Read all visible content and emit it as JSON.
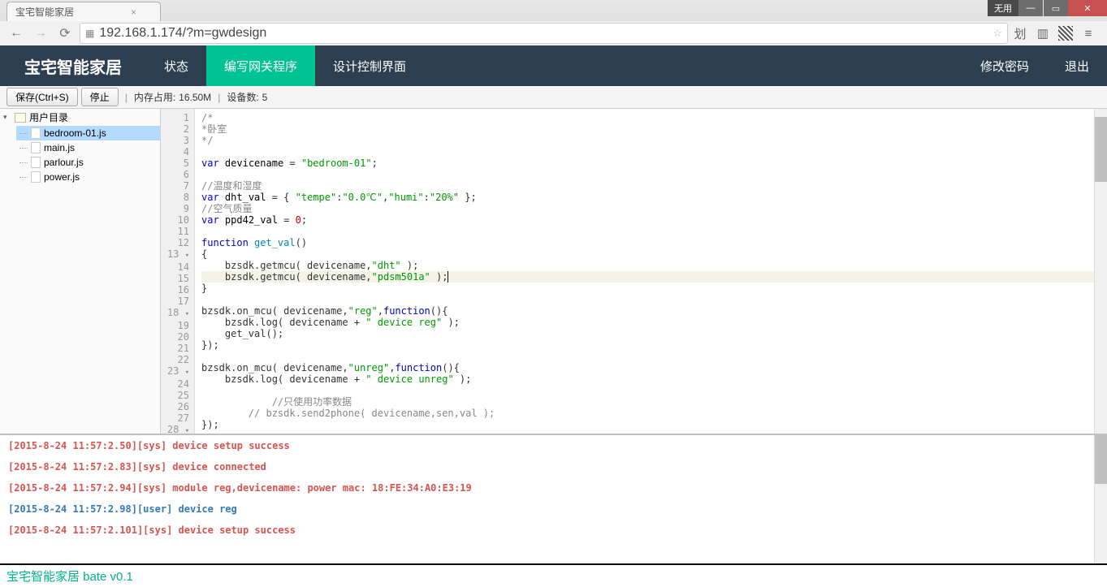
{
  "browser": {
    "tab_title": "宝宅智能家居",
    "url": "192.168.1.174/?m=gwdesign",
    "window_wy": "无用"
  },
  "nav": {
    "brand": "宝宅智能家居",
    "items": [
      "状态",
      "编写网关程序",
      "设计控制界面"
    ],
    "active": 1,
    "right": [
      "修改密码",
      "退出"
    ]
  },
  "toolbar": {
    "save": "保存(Ctrl+S)",
    "stop": "停止",
    "mem_label": "内存占用:",
    "mem_val": "16.50M",
    "dev_label": "设备数:",
    "dev_val": "5"
  },
  "tree": {
    "root": "用户目录",
    "files": [
      "bedroom-01.js",
      "main.js",
      "parlour.js",
      "power.js"
    ],
    "selected": 0
  },
  "code": {
    "lines": [
      {
        "n": 1,
        "fold": "",
        "html": "<span class='cm'>/*</span>"
      },
      {
        "n": 2,
        "fold": "",
        "html": "<span class='cm'>*卧室</span>"
      },
      {
        "n": 3,
        "fold": "",
        "html": "<span class='cm'>*/</span>"
      },
      {
        "n": 4,
        "fold": "",
        "html": " "
      },
      {
        "n": 5,
        "fold": "",
        "html": "<span class='kw'>var</span> <span class='id'>devicename</span> = <span class='str'>\"bedroom-01\"</span>;"
      },
      {
        "n": 6,
        "fold": "",
        "html": " "
      },
      {
        "n": 7,
        "fold": "",
        "html": "<span class='cm'>//温度和湿度</span>"
      },
      {
        "n": 8,
        "fold": "",
        "html": "<span class='kw'>var</span> <span class='id'>dht_val</span> = { <span class='str'>\"tempe\"</span>:<span class='str'>\"0.0℃\"</span>,<span class='str'>\"humi\"</span>:<span class='str'>\"20%\"</span> };"
      },
      {
        "n": 9,
        "fold": "",
        "html": "<span class='cm'>//空气质量</span>"
      },
      {
        "n": 10,
        "fold": "",
        "html": "<span class='kw'>var</span> <span class='id'>ppd42_val</span> = <span class='num'>0</span>;"
      },
      {
        "n": 11,
        "fold": "",
        "html": " "
      },
      {
        "n": 12,
        "fold": "",
        "html": "<span class='kw'>function</span> <span class='fn'>get_val</span>()"
      },
      {
        "n": 13,
        "fold": "▾",
        "html": "{"
      },
      {
        "n": 14,
        "fold": "",
        "html": "    bzsdk.getmcu( devicename,<span class='str'>\"dht\"</span> );"
      },
      {
        "n": 15,
        "fold": "",
        "cursor": true,
        "html": "    bzsdk.getmcu( devicename,<span class='str'>\"pdsm501a\"</span> );<span class='cursor'></span>"
      },
      {
        "n": 16,
        "fold": "",
        "html": "}"
      },
      {
        "n": 17,
        "fold": "",
        "html": " "
      },
      {
        "n": 18,
        "fold": "▾",
        "html": "bzsdk.on_mcu( devicename,<span class='str'>\"reg\"</span>,<span class='kw'>function</span>(){"
      },
      {
        "n": 19,
        "fold": "",
        "html": "    bzsdk.log( devicename + <span class='str'>\" device reg\"</span> );"
      },
      {
        "n": 20,
        "fold": "",
        "html": "    get_val();"
      },
      {
        "n": 21,
        "fold": "",
        "html": "});"
      },
      {
        "n": 22,
        "fold": "",
        "html": " "
      },
      {
        "n": 23,
        "fold": "▾",
        "html": "bzsdk.on_mcu( devicename,<span class='str'>\"unreg\"</span>,<span class='kw'>function</span>(){"
      },
      {
        "n": 24,
        "fold": "",
        "html": "    bzsdk.log( devicename + <span class='str'>\" device unreg\"</span> );"
      },
      {
        "n": 25,
        "fold": "",
        "html": " "
      },
      {
        "n": 26,
        "fold": "",
        "html": "            <span class='cm'>//只使用功率数据</span>"
      },
      {
        "n": 27,
        "fold": "",
        "html": "        <span class='cm'>// bzsdk.send2phone( devicename,sen,val );</span>"
      },
      {
        "n": 28,
        "fold": "▾",
        "html": "});"
      }
    ]
  },
  "console": {
    "lines": [
      {
        "type": "sys",
        "text": "[2015-8-24 11:57:2.50][sys] device setup success"
      },
      {
        "type": "sys",
        "text": "[2015-8-24 11:57:2.83][sys] device connected"
      },
      {
        "type": "sys",
        "text": "[2015-8-24 11:57:2.94][sys] module reg,devicename: power mac: 18:FE:34:A0:E3:19"
      },
      {
        "type": "user",
        "text": "[2015-8-24 11:57:2.98][user] device reg"
      },
      {
        "type": "sys",
        "text": "[2015-8-24 11:57:2.101][sys] device setup success"
      }
    ]
  },
  "footer": {
    "text": "宝宅智能家居 bate v0.1"
  }
}
